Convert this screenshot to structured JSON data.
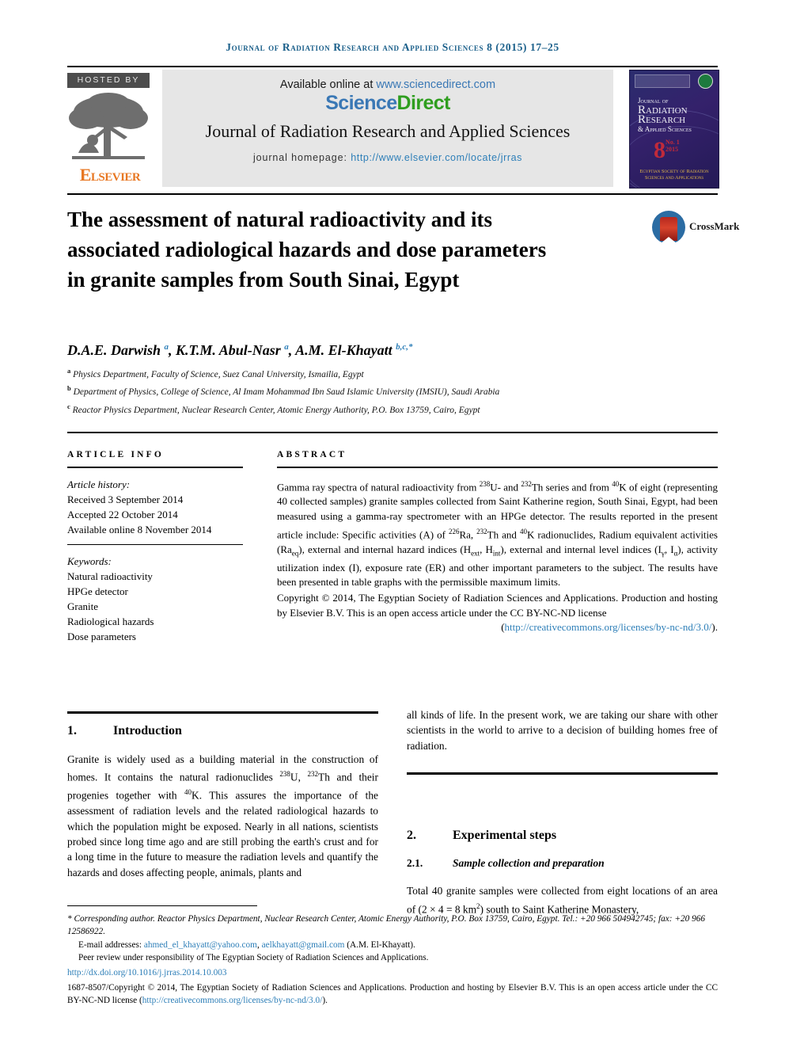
{
  "running_head": "Journal of Radiation Research and Applied Sciences 8 (2015) 17–25",
  "masthead": {
    "hosted_by": "HOSTED BY",
    "elsevier_wordmark": "Elsevier",
    "available_online_prefix": "Available online at ",
    "sciencedirect_url": "www.sciencedirect.com",
    "sciencedirect_logo_part1": "Science",
    "sciencedirect_logo_part2": "Direct",
    "journal_title": "Journal of Radiation Research and Applied Sciences",
    "homepage_label": "journal homepage: ",
    "homepage_url": "http://www.elsevier.com/locate/jrras",
    "cover": {
      "line1": "Journal of",
      "line2": "Radiation",
      "line3": "Research",
      "line4": "& Applied Sciences",
      "volume": "8",
      "volume_issue": "No. 1",
      "volume_year": "2015",
      "publisher_line1": "Egyptian Society of Radiation",
      "publisher_line2": "Sciences and Applications"
    }
  },
  "article": {
    "title": "The assessment of natural radioactivity and its associated radiological hazards and dose parameters in granite samples from South Sinai, Egypt",
    "crossmark_label": "CrossMark",
    "affiliations": [
      "Physics Department, Faculty of Science, Suez Canal University, Ismailia, Egypt",
      "Department of Physics, College of Science, Al Imam Mohammad Ibn Saud Islamic University (IMSIU), Saudi Arabia",
      "Reactor Physics Department, Nuclear Research Center, Atomic Energy Authority, P.O. Box 13759, Cairo, Egypt"
    ]
  },
  "article_info": {
    "heading": "ARTICLE INFO",
    "history_label": "Article history:",
    "history": [
      "Received 3 September 2014",
      "Accepted 22 October 2014",
      "Available online 8 November 2014"
    ],
    "keywords_label": "Keywords:",
    "keywords": [
      "Natural radioactivity",
      "HPGe detector",
      "Granite",
      "Radiological hazards",
      "Dose parameters"
    ]
  },
  "abstract": {
    "heading": "ABSTRACT",
    "copyright": "Copyright © 2014, The Egyptian Society of Radiation Sciences and Applications. Production and hosting by Elsevier B.V. This is an open access article under the CC BY-NC-ND license",
    "license_open": "(",
    "license_url": "http://creativecommons.org/licenses/by-nc-nd/3.0/",
    "license_close": ")."
  },
  "sections": {
    "intro_number": "1.",
    "intro_title": "Introduction",
    "intro_para_left": "Granite is widely used as a building material in the construction of homes. It contains the natural radionuclides",
    "intro_para_right": "all kinds of life. In the present work, we are taking our share with other scientists in the world to arrive to a decision of building homes free of radiation.",
    "exp_number": "2.",
    "exp_title": "Experimental steps",
    "exp_sub_number": "2.1.",
    "exp_sub_title": "Sample collection and preparation"
  },
  "footnotes": {
    "corresponding": "* Corresponding author. Reactor Physics Department, Nuclear Research Center, Atomic Energy Authority, P.O. Box 13759, Cairo, Egypt. Tel.: +20 966 504942745; fax: +20 966 12586922.",
    "email_label": "E-mail addresses: ",
    "email1": "ahmed_el_khayatt@yahoo.com",
    "email_sep": ", ",
    "email2": "aelkhayatt@gmail.com",
    "email_suffix": " (A.M. El-Khayatt).",
    "peer_review": "Peer review under responsibility of The Egyptian Society of Radiation Sciences and Applications.",
    "doi": "http://dx.doi.org/10.1016/j.jrras.2014.10.003",
    "issn_copyright": "1687-8507/Copyright © 2014, The Egyptian Society of Radiation Sciences and Applications. Production and hosting by Elsevier B.V. This is an open access article under the CC BY-NC-ND license (",
    "issn_license_url": "http://creativecommons.org/licenses/by-nc-nd/3.0/",
    "issn_license_close": ")."
  },
  "colors": {
    "running_head": "#1a5f8a",
    "link": "#2e7fb8",
    "elsevier_orange": "#e87722",
    "sciencedirect_green": "#2f9e1f",
    "sciencedirect_blue": "#3a78b5",
    "cover_navy": "#2b2d6e",
    "crossmark_blue": "#2b6ca3",
    "crossmark_red": "#b5281f"
  }
}
